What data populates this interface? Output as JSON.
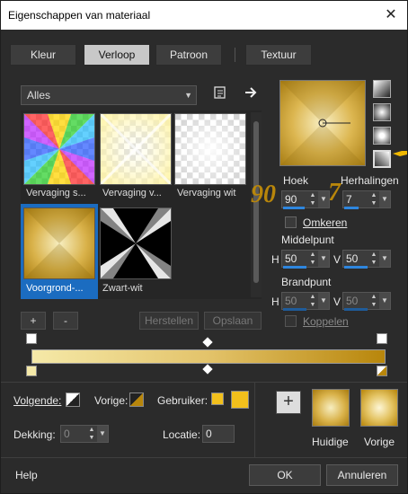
{
  "window": {
    "title": "Eigenschappen van materiaal",
    "close_glyph": "✕"
  },
  "tabs": [
    {
      "label": "Kleur",
      "active": false
    },
    {
      "label": "Verloop",
      "active": true
    },
    {
      "label": "Patroon",
      "active": false
    },
    {
      "label": "Textuur",
      "active": false
    }
  ],
  "category": {
    "value": "Alles"
  },
  "gradients": [
    {
      "label": "Vervaging s...",
      "selected": false
    },
    {
      "label": "Vervaging v...",
      "selected": false
    },
    {
      "label": "Vervaging wit",
      "selected": false
    },
    {
      "label": "Voorgrond-...",
      "selected": true
    },
    {
      "label": "Zwart-wit",
      "selected": false
    }
  ],
  "list_buttons": {
    "add": "+",
    "remove": "-",
    "restore": "Herstellen",
    "save": "Opslaan"
  },
  "settings": {
    "angle_label": "Hoek",
    "angle_value": "90",
    "repeats_label": "Herhalingen",
    "repeats_value": "7",
    "invert_label": "Omkeren",
    "center_label": "Middelpunt",
    "center_h_label": "H",
    "center_h": "50",
    "center_v_label": "V",
    "center_v": "50",
    "focal_label": "Brandpunt",
    "focal_h_label": "H",
    "focal_h": "50",
    "focal_v_label": "V",
    "focal_v": "50",
    "link_label": "Koppelen"
  },
  "overlay_numbers": {
    "angle": "90",
    "repeats": "7"
  },
  "stops": {
    "next_label": "Volgende:",
    "prev_label": "Vorige:",
    "user_label": "Gebruiker:",
    "opacity_label": "Dekking:",
    "opacity_value": "0",
    "location_label": "Locatie:",
    "location_value": "0"
  },
  "swatches": {
    "add_glyph": "+",
    "current_label": "Huidige",
    "previous_label": "Vorige"
  },
  "footer": {
    "help": "Help",
    "ok": "OK",
    "cancel": "Annuleren"
  },
  "colors": {
    "gold_dark": "#b8860b",
    "gold_light": "#f5e9a8",
    "accent": "#2e86de",
    "user_color": "#f2c01c"
  }
}
